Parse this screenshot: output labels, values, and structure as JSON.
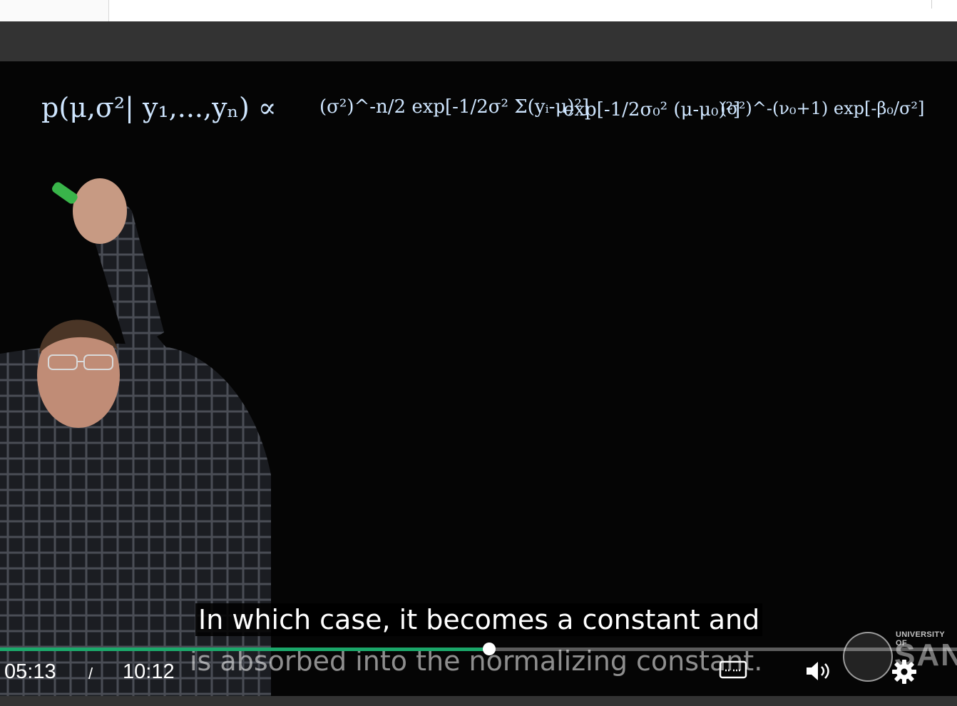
{
  "page": {
    "colors": {
      "video_background": "#050505",
      "chrome_band": "#333333",
      "progress_played": "#1ba86a",
      "chalk": "#cfe6ff"
    }
  },
  "equation": {
    "lhs": "p(μ,σ²| y₁,...,yₙ) ∝",
    "term1": "(σ²)^-n/2 exp[-1/2σ² Σ(yᵢ-μ)²]",
    "term2": "exp[-1/2σ₀² (μ-μ₀)²]",
    "term3": "(σ²)^-(ν₀+1) exp[-β₀/σ²]"
  },
  "captions": {
    "line1": "In which case, it becomes a constant and",
    "line2": "is absorbed into the normalizing constant."
  },
  "player": {
    "current_time": "05:13",
    "separator": "/",
    "total_time": "10:12",
    "progress_fraction": 0.5114,
    "icons": {
      "cc": "closed-captions-icon",
      "volume": "volume-icon",
      "settings": "gear-icon"
    }
  },
  "logo": {
    "top_text": "UNIVERSITY OF",
    "main_text": "SANTA"
  }
}
